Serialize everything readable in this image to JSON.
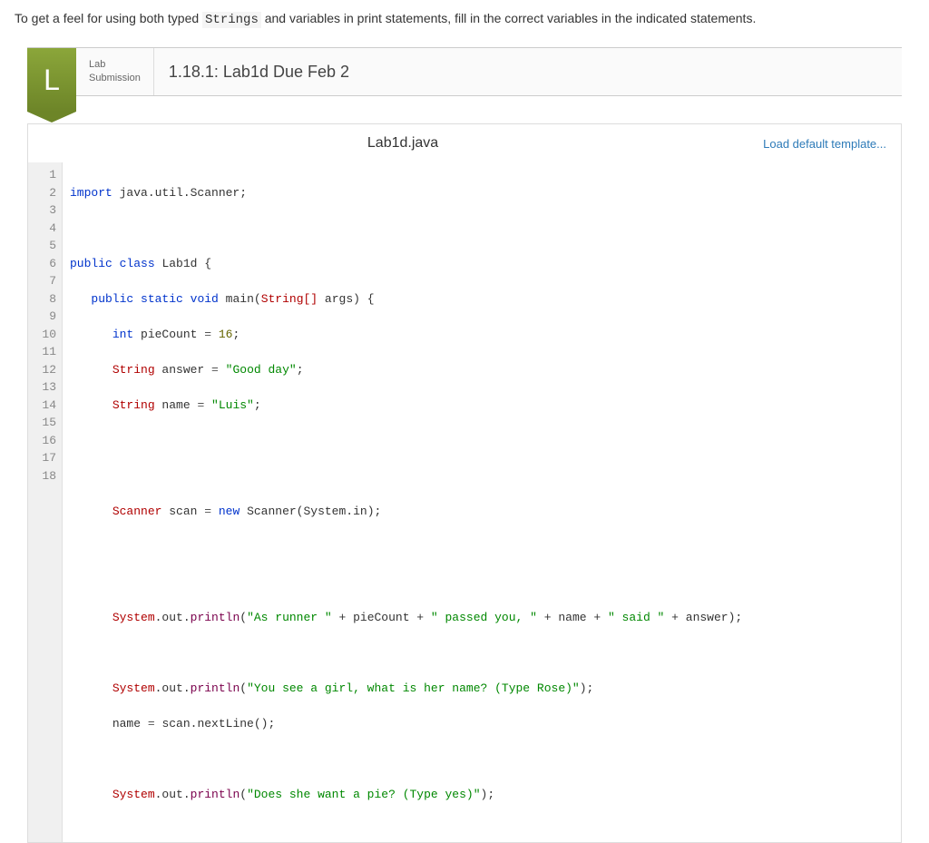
{
  "instructions": {
    "prefix": "To get a feel for using both typed ",
    "code": "Strings",
    "suffix": " and variables in print statements, fill in the correct variables in the indicated statements."
  },
  "lab": {
    "badge": "L",
    "meta_line1": "Lab",
    "meta_line2": "Submission",
    "title": "1.18.1: Lab1d Due Feb 2"
  },
  "editor": {
    "filename": "Lab1d.java",
    "load_template": "Load default template...",
    "line_numbers": [
      "1",
      "2",
      "3",
      "4",
      "5",
      "6",
      "7",
      "8",
      "9",
      "10",
      "11",
      "12",
      "13",
      "14",
      "15",
      "16",
      "17",
      "18"
    ],
    "code": {
      "l1_kw": "import",
      "l1_rest": " java.util.Scanner;",
      "l3_kw1": "public",
      "l3_kw2": "class",
      "l3_name": " Lab1d {",
      "l4_kw1": "public",
      "l4_kw2": "static",
      "l4_kw3": "void",
      "l4_main": " main(",
      "l4_type": "String[]",
      "l4_args": " args) {",
      "l5_type": "int",
      "l5_var": " pieCount ",
      "l5_eq": "=",
      "l5_num": " 16",
      "l5_end": ";",
      "l6_type": "String",
      "l6_var": " answer ",
      "l6_eq": "=",
      "l6_str": " \"Good day\"",
      "l6_end": ";",
      "l7_type": "String",
      "l7_var": " name ",
      "l7_eq": "=",
      "l7_str": " \"Luis\"",
      "l7_end": ";",
      "l10_type": "Scanner",
      "l10_var": " scan ",
      "l10_eq": "=",
      "l10_new": " new",
      "l10_ctor": " Scanner(System.in)",
      "l10_end": ";",
      "l13_sys": "System",
      "l13_out": ".out.",
      "l13_m": "println",
      "l13_open": "(",
      "l13_s1": "\"As runner \"",
      "l13_p1": " + pieCount + ",
      "l13_s2": "\" passed you, \"",
      "l13_p2": " + name + ",
      "l13_s3": "\" said \"",
      "l13_p3": " + answer);",
      "l15_sys": "System",
      "l15_out": ".out.",
      "l15_m": "println",
      "l15_open": "(",
      "l15_s": "\"You see a girl, what is her name? (Type Rose)\"",
      "l15_end": ");",
      "l16_var": "name ",
      "l16_eq": "=",
      "l16_call": " scan.nextLine();",
      "l18_sys": "System",
      "l18_out": ".out.",
      "l18_m": "println",
      "l18_open": "(",
      "l18_s": "\"Does she want a pie? (Type yes)\"",
      "l18_end": ");"
    }
  }
}
